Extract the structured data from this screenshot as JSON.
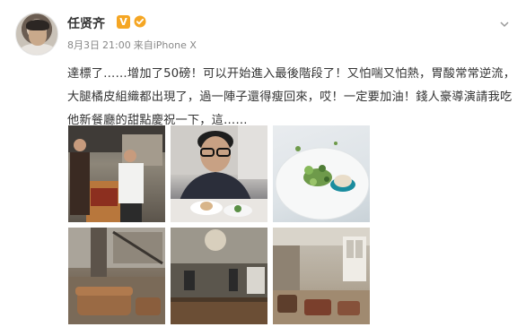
{
  "user": {
    "name": "任贤齐",
    "badge": "V",
    "date": "8月3日",
    "time": "21:00",
    "source": "来自iPhone X"
  },
  "post": {
    "text": "達標了……增加了50磅！可以开始進入最後階段了！又怕喘又怕熱，胃酸常常逆流，大腿橘皮組織都出現了，過一陣子還得瘦回來，哎！一定要加油！錢人豪導演請我吃他新餐廳的甜點慶祝一下，這……"
  },
  "photos": [
    {
      "name": "photo-kitchen-chefs"
    },
    {
      "name": "photo-man-at-table"
    },
    {
      "name": "photo-dessert-plate"
    },
    {
      "name": "photo-loft-interior"
    },
    {
      "name": "photo-open-kitchen"
    },
    {
      "name": "photo-dining-room"
    }
  ],
  "colors": {
    "badge": "#f5a623",
    "meta": "#888888",
    "text": "#333333"
  }
}
